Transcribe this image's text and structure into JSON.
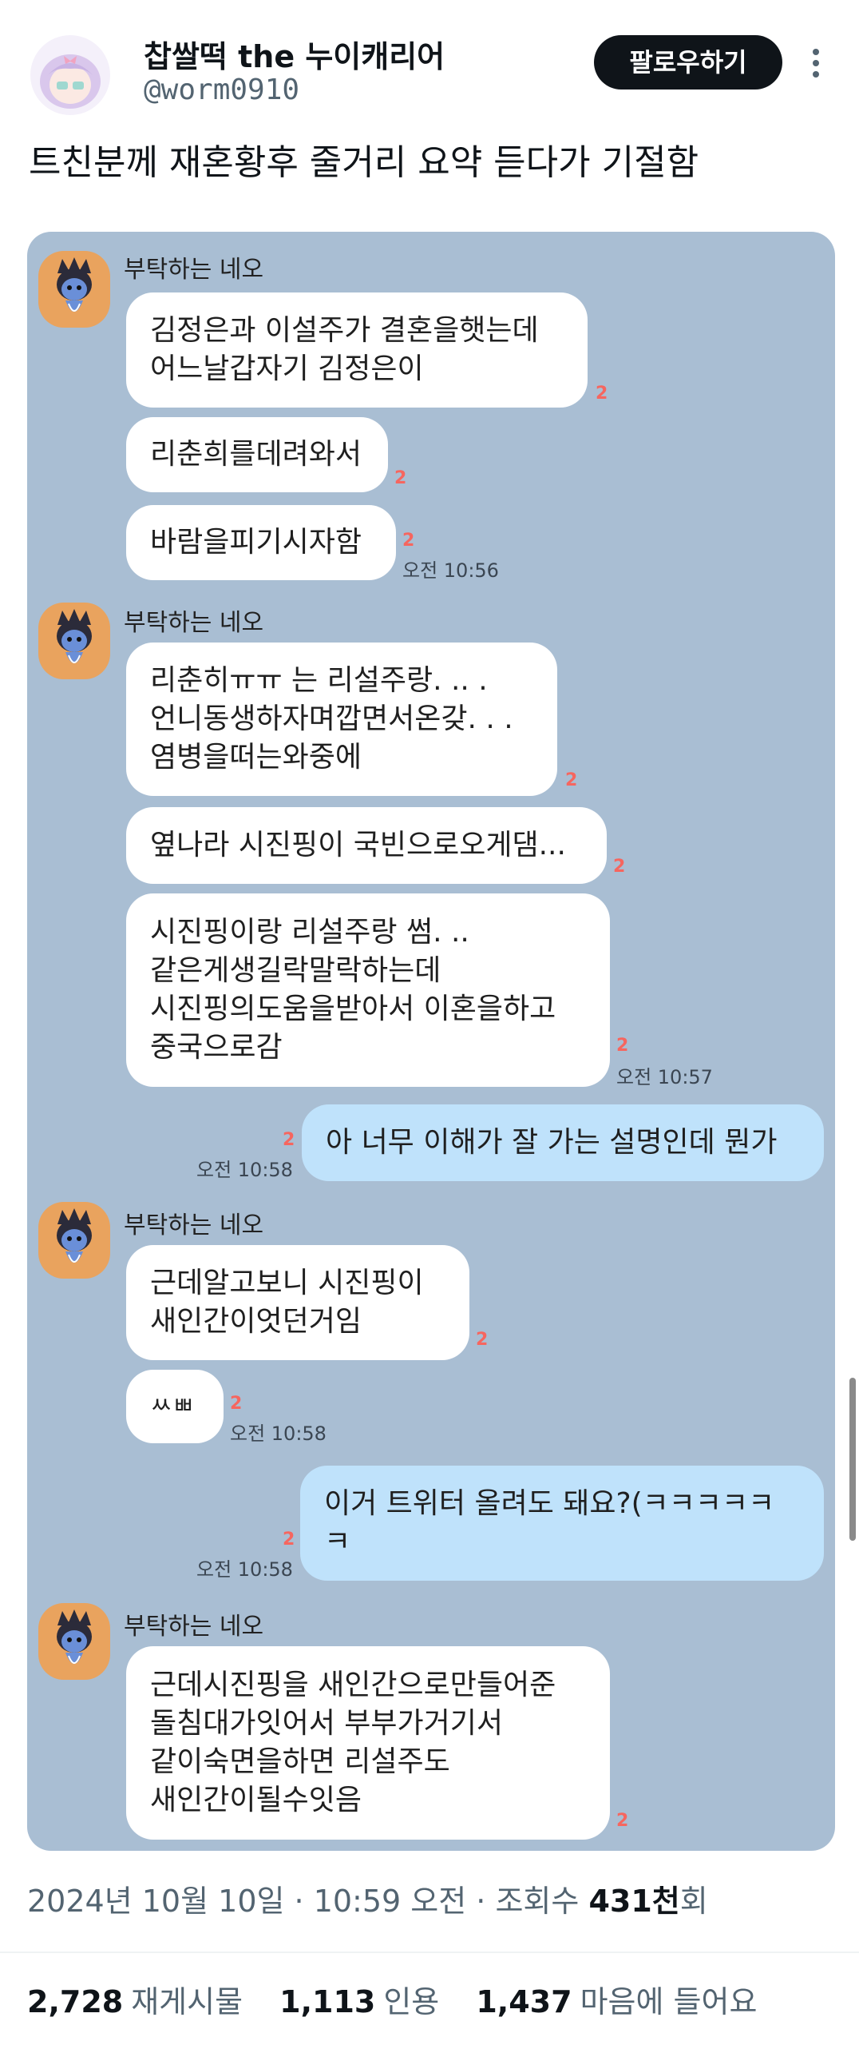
{
  "author": {
    "display_name": "찹쌀떡 the 누이캐리어",
    "handle": "@worm0910",
    "avatar_icon": "anime-girl-avatar"
  },
  "follow_label": "팔로우하기",
  "tweet_text": "트친분께 재혼황후 줄거리 요약 듣다가 기절함",
  "chat": {
    "background": "#a9bed3",
    "sender": "부탁하는 네오",
    "messages": [
      {
        "lines": [
          "김정은과 이설주가 결혼을햇는데",
          "어느날갑자기 김정은이"
        ],
        "unread": "2"
      },
      {
        "lines": [
          "리춘희를데려와서"
        ],
        "unread": "2"
      },
      {
        "lines": [
          "바람을피기시자함"
        ],
        "unread": "2",
        "time": "오전 10:56"
      },
      {
        "lines": [
          "리춘히ㅠㅠ 는 리설주랑. .. .",
          "언니동생하자며깝면서온갖. . .",
          "염병을떠는와중에"
        ],
        "unread": "2"
      },
      {
        "lines": [
          "옆나라 시진핑이 국빈으로오게댐..."
        ],
        "unread": "2"
      },
      {
        "lines": [
          "시진핑이랑 리설주랑 썸. ..",
          "같은게생길락말락하는데",
          "시진핑의도움을받아서 이혼을하고",
          "중국으로감"
        ],
        "unread": "2",
        "time": "오전 10:57"
      },
      {
        "lines": [
          "아 너무 이해가 잘 가는 설명인데 뭔가"
        ],
        "unread": "2",
        "time": "오전 10:58"
      },
      {
        "lines": [
          "근데알고보니 시진핑이",
          "새인간이엇던거임"
        ],
        "unread": "2"
      },
      {
        "lines": [
          "ㅆㅃ"
        ],
        "unread": "2",
        "time": "오전 10:58"
      },
      {
        "lines": [
          "이거 트위터 올려도 돼요?(ㅋㅋㅋㅋㅋ",
          "ㅋ"
        ],
        "unread": "2",
        "time": "오전 10:58"
      },
      {
        "lines": [
          "근데시진핑을 새인간으로만들어준",
          "돌침대가잇어서 부부가거기서",
          "같이숙면을하면 리설주도",
          "새인간이될수잇음"
        ],
        "unread": "2"
      }
    ]
  },
  "meta": {
    "date": "2024년 10월 10일",
    "sep1": " · ",
    "time": "10:59 오전",
    "sep2": " · ",
    "views_label": "조회수 ",
    "views_count": "431천",
    "views_suffix": "회"
  },
  "stats": {
    "retweets_count": "2,728",
    "retweets_label": "재게시물",
    "quotes_count": "1,113",
    "quotes_label": "인용",
    "likes_count": "1,437",
    "likes_label": "마음에 들어요"
  }
}
